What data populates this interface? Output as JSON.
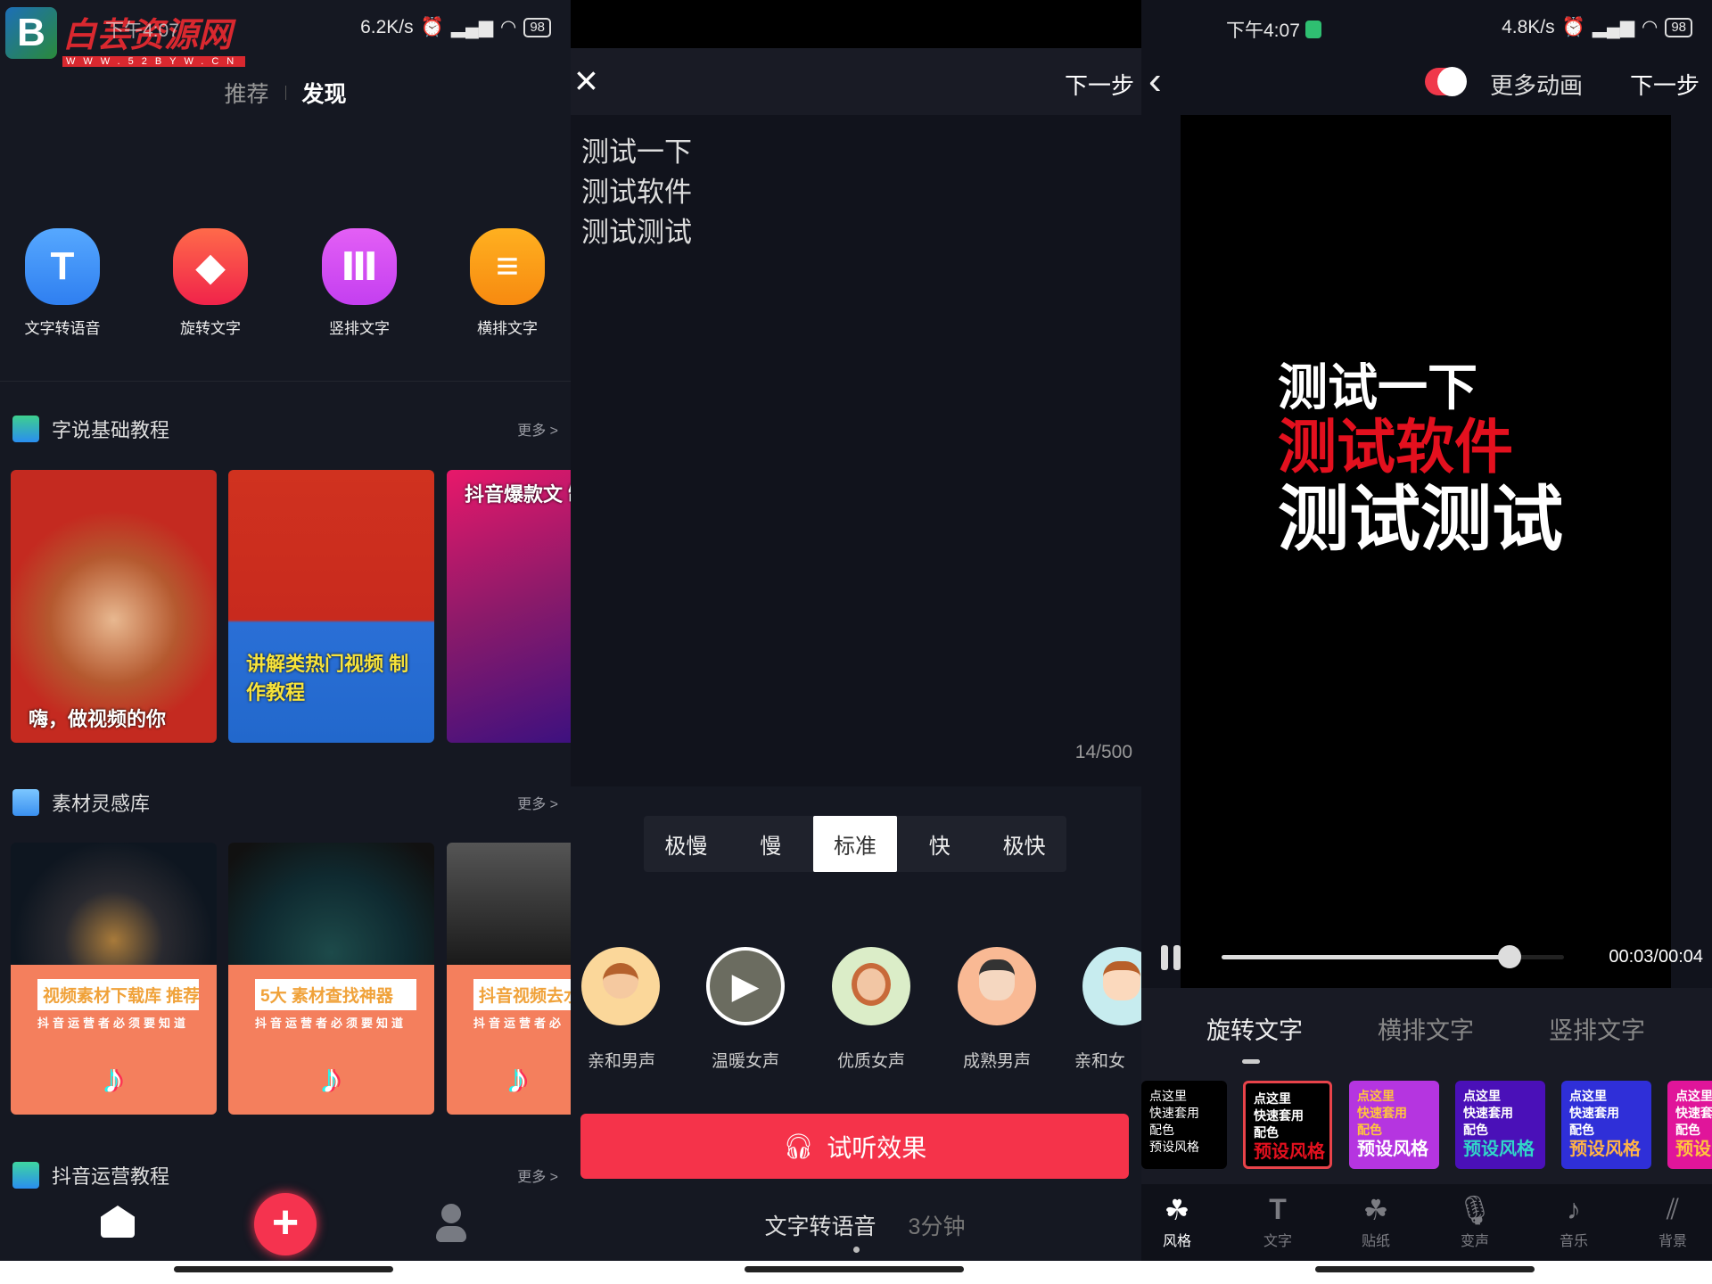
{
  "panel1": {
    "status": {
      "time": "下午4:07",
      "speed": "6.2K/s",
      "battery": "98"
    },
    "watermark": {
      "title": "白芸资源网",
      "url": "WWW.52BYW.CN"
    },
    "tabs": [
      {
        "label": "推荐",
        "active": false
      },
      {
        "label": "发现",
        "active": true
      }
    ],
    "functions": [
      {
        "label": "文字转语音",
        "icon": "text-T-icon",
        "color": "#3f8ff5"
      },
      {
        "label": "旋转文字",
        "icon": "rotate-text-icon",
        "color": "#f0413f"
      },
      {
        "label": "竖排文字",
        "icon": "vertical-text-icon",
        "color": "#d24cf0"
      },
      {
        "label": "横排文字",
        "icon": "horizontal-text-icon",
        "color": "#f79a1a"
      }
    ],
    "sections": [
      {
        "title": "字说基础教程",
        "more": "更多 >",
        "cards": [
          "嗨，做视频的你",
          "讲解类热门视频 制作教程",
          "抖音爆款文 制作教"
        ]
      },
      {
        "title": "素材灵感库",
        "more": "更多 >",
        "cards": [
          {
            "tag": "视频素材下载库 推荐",
            "sub": "抖音运营者必须要知道"
          },
          {
            "tag": "5大 素材查找神器",
            "sub": "抖音运营者必须要知道"
          },
          {
            "tag": "抖音视频去水",
            "sub": "抖音运营者必"
          }
        ]
      },
      {
        "title": "抖音运营教程",
        "more": "更多 >"
      }
    ],
    "bottom_nav": [
      "home-icon",
      "plus-icon",
      "profile-icon"
    ]
  },
  "panel2": {
    "close": "×",
    "next": "下一步",
    "text_lines": [
      "测试一下",
      "测试软件",
      "测试测试"
    ],
    "counter": "14/500",
    "speeds": [
      {
        "label": "极慢"
      },
      {
        "label": "慢"
      },
      {
        "label": "标准",
        "selected": true
      },
      {
        "label": "快"
      },
      {
        "label": "极快"
      }
    ],
    "voices": [
      {
        "label": "亲和男声",
        "bg": "#fbd79a"
      },
      {
        "label": "温暖女声",
        "bg": "#6b6c60",
        "playing": true
      },
      {
        "label": "优质女声",
        "bg": "#dbedc8"
      },
      {
        "label": "成熟男声",
        "bg": "#f9b994"
      },
      {
        "label": "亲和女",
        "bg": "#c7ecef"
      }
    ],
    "listen_button": "试听效果",
    "footer_tabs": [
      {
        "label": "文字转语音",
        "active": true
      },
      {
        "label": "3分钟",
        "active": false
      }
    ]
  },
  "panel3": {
    "status": {
      "time": "下午4:07",
      "speed": "4.8K/s",
      "battery": "98"
    },
    "toggle_label": "更多动画",
    "toggle_on": true,
    "next": "下一步",
    "preview_lines": [
      {
        "text": "测试一下",
        "color": "#ffffff"
      },
      {
        "text": "测试软件",
        "color": "#e3101e"
      },
      {
        "text": "测试测试",
        "color": "#ffffff"
      }
    ],
    "progress": 0.84,
    "time": "00:03/00:04",
    "tabs": [
      {
        "label": "旋转文字",
        "active": true
      },
      {
        "label": "横排文字"
      },
      {
        "label": "竖排文字"
      }
    ],
    "styles": [
      {
        "lines": [
          "点这里",
          "快速套用",
          "配色",
          "预设风格"
        ],
        "bg": "#000000",
        "fg": "#ffffff",
        "accent": "#ffffff"
      },
      {
        "lines": [
          "点这里",
          "快速套用",
          "配色",
          "预设风格"
        ],
        "bg": "#000000",
        "fg": "#ffffff",
        "accent": "#e3101e",
        "selected": true
      },
      {
        "lines": [
          "点这里",
          "快速套用",
          "配色",
          "预设风格"
        ],
        "bg": "#b535e0",
        "fg": "#ffc53d",
        "accent": "#ffffff"
      },
      {
        "lines": [
          "点这里",
          "快速套用",
          "配色",
          "预设风格"
        ],
        "bg": "#4a10b8",
        "fg": "#ffffff",
        "accent": "#31d6c9"
      },
      {
        "lines": [
          "点这里",
          "快速套用",
          "配色",
          "预设风格"
        ],
        "bg": "#2f2fd8",
        "fg": "#ffffff",
        "accent": "#ffb347"
      },
      {
        "lines": [
          "点这里",
          "快速套",
          "配色",
          "预设"
        ],
        "bg": "#e0159a",
        "fg": "#ffffff",
        "accent": "#ffc53d"
      }
    ],
    "tools": [
      {
        "label": "风格",
        "icon": "style-icon",
        "active": true
      },
      {
        "label": "文字",
        "icon": "text-icon"
      },
      {
        "label": "贴纸",
        "icon": "sticker-icon"
      },
      {
        "label": "变声",
        "icon": "microphone-icon"
      },
      {
        "label": "音乐",
        "icon": "music-note-icon"
      },
      {
        "label": "背景",
        "icon": "background-icon"
      }
    ]
  }
}
